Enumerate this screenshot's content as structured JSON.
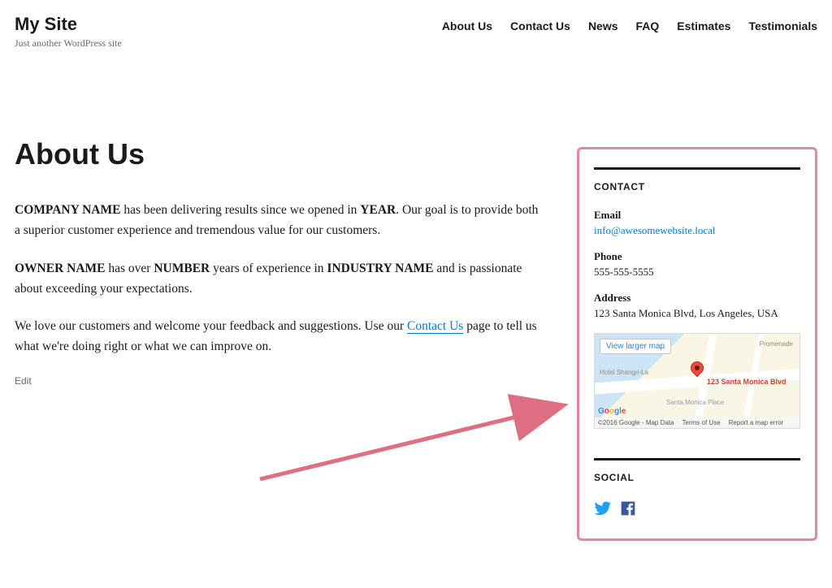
{
  "site": {
    "title": "My Site",
    "tagline": "Just another WordPress site"
  },
  "nav": {
    "about": "About Us",
    "contact": "Contact Us",
    "news": "News",
    "faq": "FAQ",
    "estimates": "Estimates",
    "testimonials": "Testimonials"
  },
  "page": {
    "title": "About Us",
    "p1_b1": "COMPANY NAME",
    "p1_mid1": " has been delivering results since we opened in ",
    "p1_b2": "YEAR",
    "p1_end1": ". Our goal is to provide both a superior customer experience and tremendous value for our customers.",
    "p2_b1": "OWNER NAME",
    "p2_mid1": " has over ",
    "p2_b2": "NUMBER",
    "p2_mid2": " years of experience in ",
    "p2_b3": "INDUSTRY NAME",
    "p2_end": " and is passionate about exceeding your expectations.",
    "p3_pre": "We love our customers and welcome your feedback and suggestions. Use our ",
    "p3_link": "Contact Us",
    "p3_post": " page to tell us what we're doing right or what we can improve on.",
    "edit": "Edit"
  },
  "sidebar": {
    "contact": {
      "title": "CONTACT",
      "email_label": "Email",
      "email_value": "info@awesomewebsite.local",
      "phone_label": "Phone",
      "phone_value": "555-555-5555",
      "address_label": "Address",
      "address_value": "123 Santa Monica Blvd, Los Angeles, USA"
    },
    "map": {
      "view_larger": "View larger map",
      "pin_label": "123 Santa Monica Blvd",
      "hotel": "Hotel Shangri-La",
      "place": "Santa Monica Place",
      "promenade": "Promenade",
      "attrib_copy": "©2016 Google - Map Data",
      "attrib_terms": "Terms of Use",
      "attrib_report": "Report a map error"
    },
    "social": {
      "title": "SOCIAL"
    }
  },
  "colors": {
    "link": "#007acc",
    "highlight_border": "#e38a98",
    "twitter": "#1DA1F2",
    "facebook": "#3b5998"
  }
}
